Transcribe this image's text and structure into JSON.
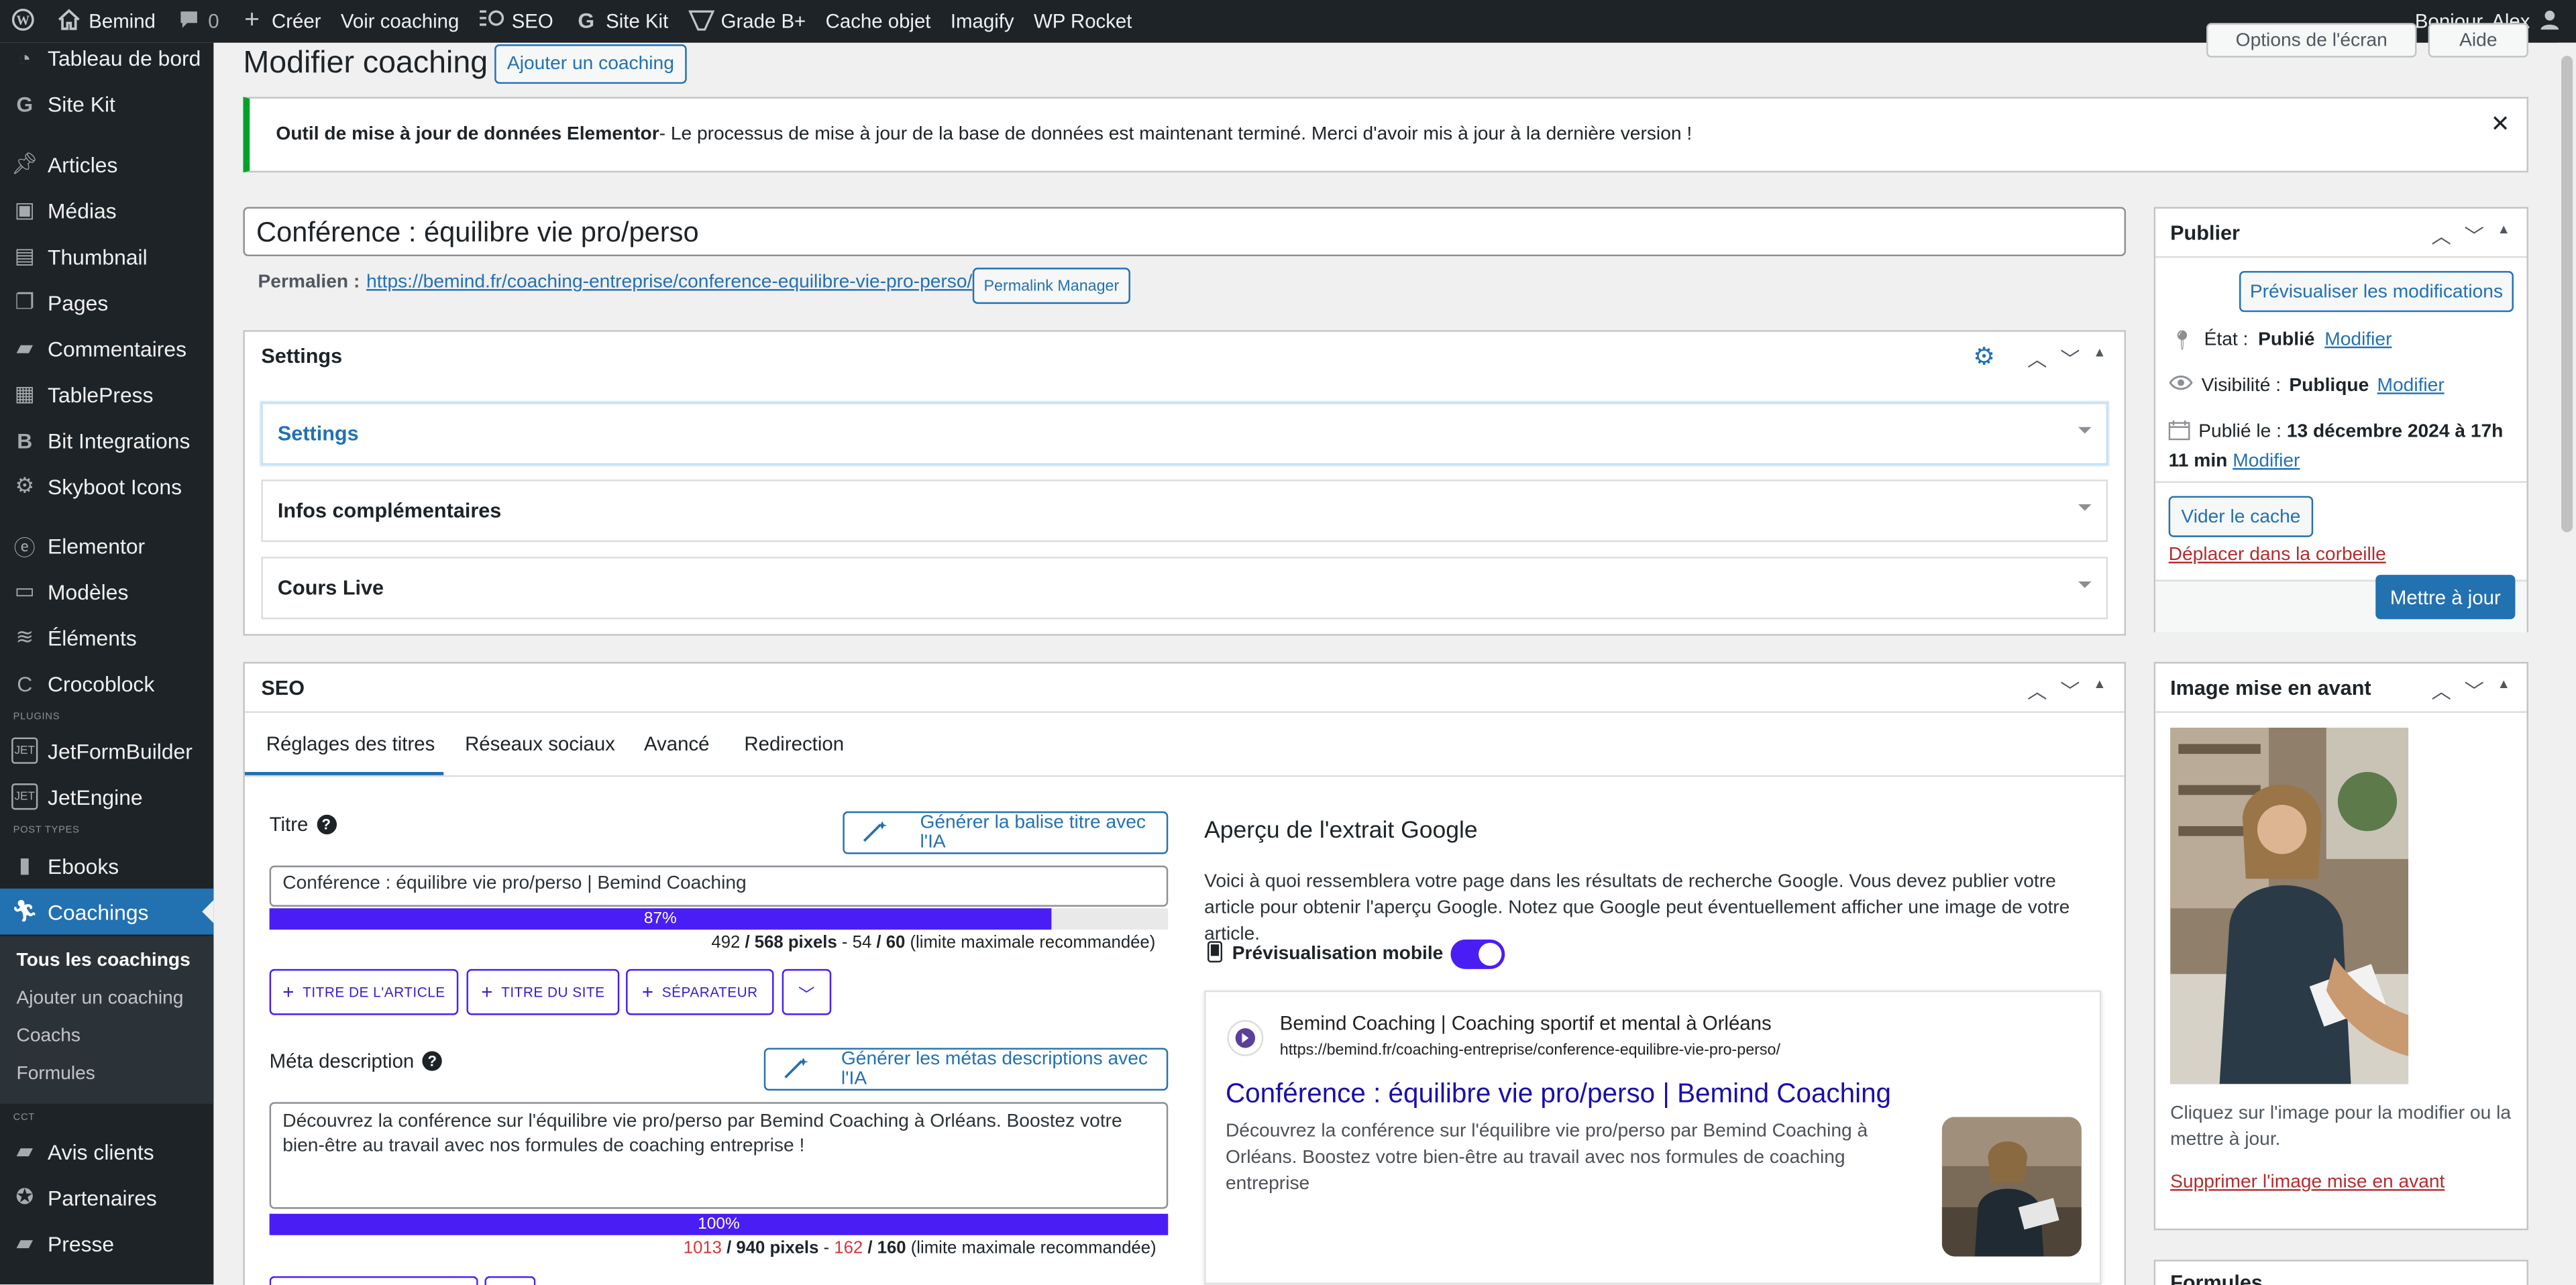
{
  "admin_bar": {
    "site_name": "Bemind",
    "comments_count": "0",
    "items": [
      "Créer",
      "Voir coaching",
      "SEO",
      "Site Kit",
      "Grade B+",
      "Cache objet",
      "Imagify",
      "WP Rocket"
    ],
    "greeting": "Bonjour, Alex"
  },
  "sidebar": {
    "items": [
      {
        "label": "Tableau de bord",
        "icon": "dashboard-icon"
      },
      {
        "label": "Site Kit",
        "icon": "sitekit-icon"
      },
      {
        "label": "Articles",
        "icon": "pin-icon"
      },
      {
        "label": "Médias",
        "icon": "media-icon"
      },
      {
        "label": "Thumbnail",
        "icon": "thumbnail-icon"
      },
      {
        "label": "Pages",
        "icon": "pages-icon"
      },
      {
        "label": "Commentaires",
        "icon": "comments-icon"
      },
      {
        "label": "TablePress",
        "icon": "table-icon"
      },
      {
        "label": "Bit Integrations",
        "icon": "bit-icon"
      },
      {
        "label": "Skyboot Icons",
        "icon": "gear-icon"
      },
      {
        "label": "Elementor",
        "icon": "elementor-icon"
      },
      {
        "label": "Modèles",
        "icon": "folder-icon"
      },
      {
        "label": "Éléments",
        "icon": "stack-icon"
      },
      {
        "label": "Crocoblock",
        "icon": "crocoblock-icon"
      },
      {
        "label": "JetFormBuilder",
        "icon": "jet-icon"
      },
      {
        "label": "JetEngine",
        "icon": "jet-icon"
      },
      {
        "label": "Ebooks",
        "icon": "book-icon"
      },
      {
        "label": "Coachings",
        "icon": "person-icon"
      },
      {
        "label": "Avis clients",
        "icon": "comments-icon"
      },
      {
        "label": "Partenaires",
        "icon": "badge-icon"
      },
      {
        "label": "Presse",
        "icon": "comments-icon"
      }
    ],
    "section_plugins": "PLUGINS",
    "section_post_types": "POST TYPES",
    "section_cct": "CCT",
    "submenu": [
      "Tous les coachings",
      "Ajouter un coaching",
      "Coachs",
      "Formules"
    ]
  },
  "page": {
    "title": "Modifier coaching",
    "add_button": "Ajouter un coaching",
    "screen_options": "Options de l'écran",
    "help": "Aide"
  },
  "notice": {
    "strong": "Outil de mise à jour de données Elementor",
    "text": " - Le processus de mise à jour de la base de données est maintenant terminé. Merci d'avoir mis à jour à la dernière version !"
  },
  "post": {
    "title": "Conférence : équilibre vie pro/perso",
    "permalink_label": "Permalien :",
    "permalink_url": "https://bemind.fr/coaching-entreprise/conference-equilibre-vie-pro-perso/",
    "permalink_manager": "Permalink Manager"
  },
  "settings_box": {
    "title": "Settings",
    "sections": [
      "Settings",
      "Infos complémentaires",
      "Cours Live"
    ]
  },
  "seo": {
    "title": "SEO",
    "tabs": [
      "Réglages des titres",
      "Réseaux sociaux",
      "Avancé",
      "Redirection"
    ],
    "title_label": "Titre",
    "ai_title_button": "Générer la balise titre avec l'IA",
    "title_value": "Conférence : équilibre vie pro/perso | Bemind Coaching",
    "title_progress": 87,
    "title_progress_label": "87%",
    "title_pixels": "492",
    "title_pixels_max": "/ 568 pixels",
    "title_chars_sep": " - ",
    "title_chars": "54",
    "title_chars_max": "/ 60",
    "limit_text": "(limite maximale recommandée)",
    "chips": [
      "TITRE DE L'ARTICLE",
      "TITRE DU SITE",
      "SÉPARATEUR"
    ],
    "meta_label": "Méta description",
    "ai_meta_button": "Générer les métas descriptions avec l'IA",
    "meta_value": "Découvrez la conférence sur l'équilibre vie pro/perso par Bemind Coaching à Orléans. Boostez votre bien-être au travail avec nos formules de coaching entreprise !",
    "meta_progress": 100,
    "meta_progress_label": "100%",
    "meta_pixels": "1013",
    "meta_pixels_max": "/ 940 pixels",
    "meta_chars_sep": " - ",
    "meta_chars": "162",
    "meta_chars_max": "/ 160",
    "accent": "#4a1df5",
    "over_limit_color": "#d63638"
  },
  "google_preview": {
    "heading": "Aperçu de l'extrait Google",
    "description": "Voici à quoi ressemblera votre page dans les résultats de recherche Google. Vous devez publier votre article pour obtenir l'aperçu Google. Notez que Google peut éventuellement afficher une image de votre article.",
    "mobile_label": "Prévisualisation mobile",
    "mobile_enabled": true,
    "site_name": "Bemind Coaching | Coaching sportif et mental à Orléans",
    "url": "https://bemind.fr/coaching-entreprise/conference-equilibre-vie-pro-perso/",
    "result_title": "Conférence : équilibre vie pro/perso | Bemind Coaching",
    "result_desc": "Découvrez la conférence sur l'équilibre vie pro/perso par Bemind Coaching à Orléans. Boostez votre bien-être au travail avec nos formules de coaching entreprise"
  },
  "publish": {
    "title": "Publier",
    "preview_button": "Prévisualiser les modifications",
    "status_label": "État :",
    "status_value": "Publié",
    "visibility_label": "Visibilité :",
    "visibility_value": "Publique",
    "published_label": "Publié le :",
    "published_value": "13 décembre 2024 à 17h 11 min",
    "modify": "Modifier",
    "clear_cache": "Vider le cache",
    "trash": "Déplacer dans la corbeille",
    "update": "Mettre à jour"
  },
  "featured": {
    "title": "Image mise en avant",
    "hint": "Cliquez sur l'image pour la modifier ou la mettre à jour.",
    "remove": "Supprimer l'image mise en avant"
  },
  "formules_box": {
    "title": "Formules"
  }
}
